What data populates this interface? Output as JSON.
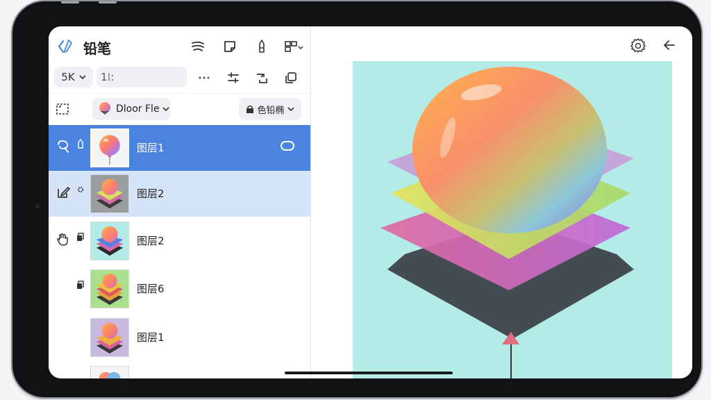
{
  "app": {
    "title": "铅笔"
  },
  "toolbar": {
    "icons": [
      "wind-icon",
      "note-icon",
      "pen-icon",
      "grid-menu-icon"
    ]
  },
  "brush": {
    "size_value": "5K",
    "opacity_value": "1⁞:",
    "row_icons": [
      "more-icon",
      "adjust-icon",
      "transform-icon",
      "copy-icon"
    ]
  },
  "layer_controls": {
    "layer_select_label": "Dloor Fle",
    "blend_mode_label": "色铅椭"
  },
  "layers": [
    {
      "name": "图层1",
      "state": "active",
      "icon": "lasso-icon"
    },
    {
      "name": "图层2",
      "state": "hover",
      "icon": "edit-layer-icon"
    },
    {
      "name": "图层2",
      "state": "normal",
      "icon": "hand-icon"
    },
    {
      "name": "图层6",
      "state": "normal",
      "icon": ""
    },
    {
      "name": "图层1",
      "state": "normal",
      "icon": ""
    }
  ],
  "colors": {
    "accent": "#4a84e0",
    "hover": "#d6e4f7",
    "canvas_bg": "#b3ece6"
  },
  "canvas": {
    "icons": [
      "settings-icon",
      "back-arrow-icon"
    ]
  }
}
